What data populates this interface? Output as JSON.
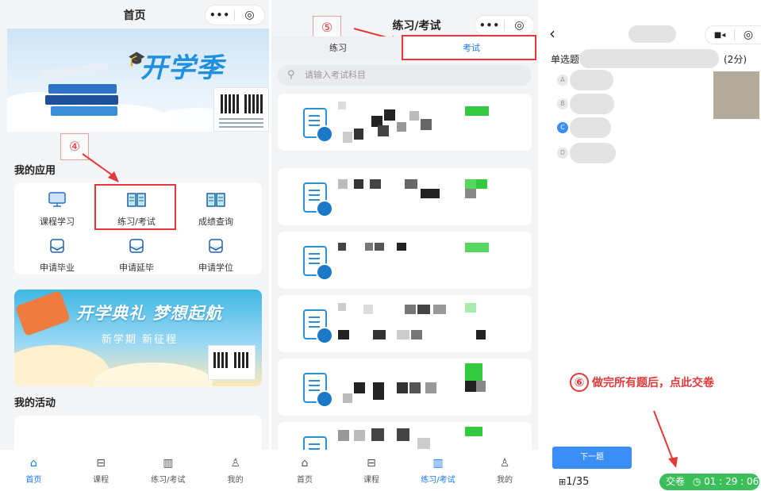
{
  "panel1": {
    "title": "首页",
    "capsule_dots": "•••",
    "capsule_rec": "◎",
    "banner_text": "开学季",
    "section_apps": "我的应用",
    "apps": [
      {
        "label": "课程学习",
        "icon": "monitor-icon"
      },
      {
        "label": "练习/考试",
        "icon": "open-book-icon"
      },
      {
        "label": "成绩查询",
        "icon": "open-book-icon"
      },
      {
        "label": "申请毕业",
        "icon": "envelope-icon"
      },
      {
        "label": "申请延毕",
        "icon": "envelope-icon"
      },
      {
        "label": "申请学位",
        "icon": "envelope-icon"
      }
    ],
    "annotation_step": "④",
    "banner2_title": "开学典礼 梦想起航",
    "banner2_subtitle": "新学期 新征程",
    "section_activities": "我的活动",
    "tabs": [
      {
        "label": "首页",
        "active": true
      },
      {
        "label": "课程",
        "active": false
      },
      {
        "label": "练习/考试",
        "active": false
      },
      {
        "label": "我的",
        "active": false
      }
    ]
  },
  "panel2": {
    "title": "练习/考试",
    "capsule_dots": "•••",
    "capsule_rec": "◎",
    "annotation_step": "⑤",
    "segments": [
      "练习",
      "考试"
    ],
    "active_segment": "考试",
    "search_placeholder": "请输入考试科目",
    "tabs": [
      {
        "label": "首页",
        "active": false
      },
      {
        "label": "课程",
        "active": false
      },
      {
        "label": "练习/考试",
        "active": true
      },
      {
        "label": "我的",
        "active": false
      }
    ]
  },
  "panel3": {
    "back": "‹",
    "question_type": "单选题",
    "score": "(2分)",
    "options": [
      "A",
      "B",
      "C",
      "D"
    ],
    "selected_option": "C",
    "annotation_step": "⑥",
    "annotation_text": "做完所有题后，点此交卷",
    "next_button": "下一题",
    "progress": "1/35",
    "submit_label": "交卷",
    "timer": "01 : 29 : 06"
  },
  "colors": {
    "accent": "#1677ff",
    "annotation": "#e23a3a",
    "submit": "#3cbf5a"
  }
}
